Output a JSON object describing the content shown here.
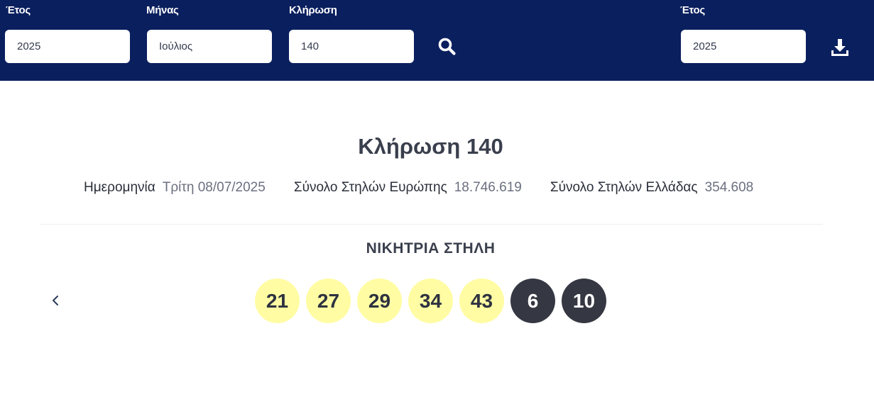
{
  "filters": {
    "year_label": "Έτος",
    "year_value": "2025",
    "month_label": "Μήνας",
    "month_value": "Ιούλιος",
    "draw_label": "Κλήρωση",
    "draw_value": "140",
    "search_icon": "search-icon",
    "export_year_label": "Έτος",
    "export_year_value": "2025",
    "download_icon": "download-icon"
  },
  "draw": {
    "title": "Κλήρωση 140",
    "date_label": "Ημερομηνία",
    "date_value": "Τρίτη 08/07/2025",
    "europe_label": "Σύνολο Στηλών Ευρώπης",
    "europe_value": "18.746.619",
    "greece_label": "Σύνολο Στηλών Ελλάδας",
    "greece_value": "354.608",
    "winning_label": "ΝΙΚΗΤΡΙΑ ΣΤΗΛΗ",
    "main_numbers": [
      "21",
      "27",
      "29",
      "34",
      "43"
    ],
    "euro_numbers": [
      "6",
      "10"
    ]
  },
  "colors": {
    "header_bg": "#0a1f5e",
    "main_ball": "#fffca3",
    "euro_ball": "#353842"
  }
}
